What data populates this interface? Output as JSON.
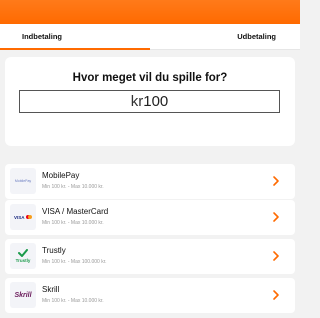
{
  "tabs": {
    "deposit_label": "Indbetaling",
    "withdraw_label": "Udbetaling",
    "active": "deposit"
  },
  "amount": {
    "question": "Hvor meget vil du spille for?",
    "currency": "kr",
    "value": "100"
  },
  "methods": [
    {
      "name": "MobilePay",
      "limit": "Min 100 kr. - Max 10.000 kr.",
      "logo_text": "MobilePay",
      "icon": "mobilepay-logo"
    },
    {
      "name": "VISA / MasterCard",
      "limit": "Min 100 kr. - Max 10.000 kr.",
      "logo_text": "VISA",
      "icon": "visa-mastercard-logo"
    },
    {
      "name": "Trustly",
      "limit": "Min 100 kr. - Max 100.000 kr.",
      "logo_text": "Trustly",
      "icon": "trustly-logo"
    },
    {
      "name": "Skrill",
      "limit": "Min 100 kr. - Max 10.000 kr.",
      "logo_text": "Skrill",
      "icon": "skrill-logo"
    }
  ],
  "colors": {
    "accent": "#ff6a00",
    "background": "#f2f2f2",
    "card": "#ffffff"
  }
}
